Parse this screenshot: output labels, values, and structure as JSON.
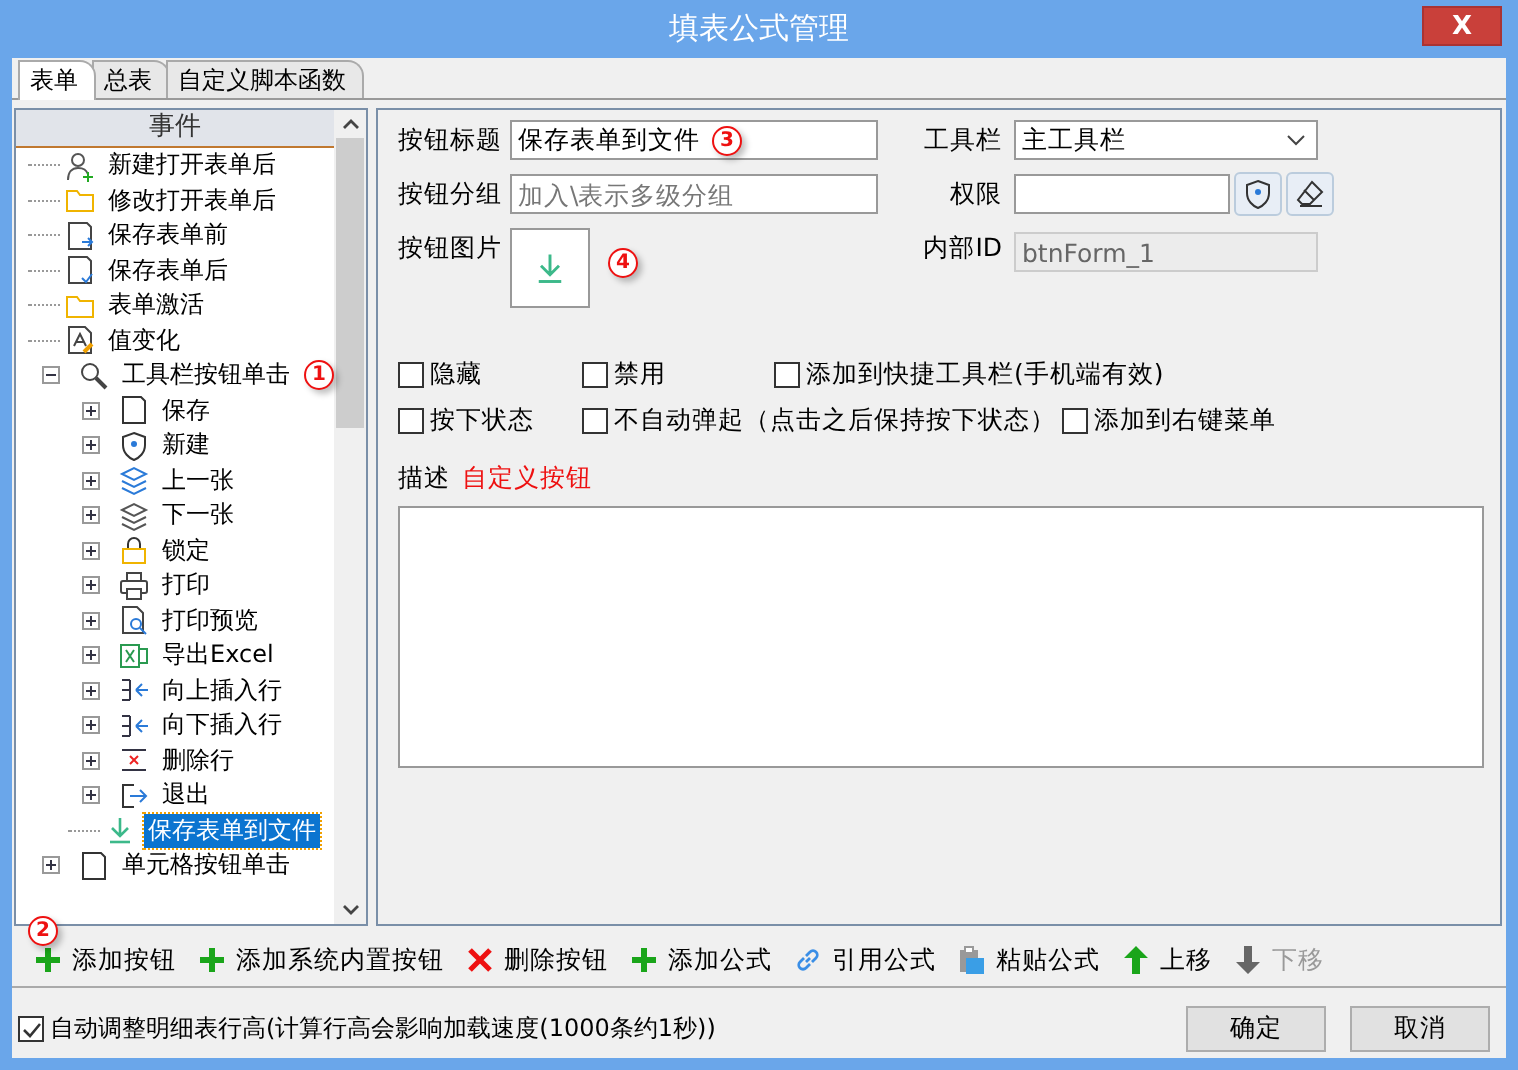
{
  "window": {
    "title": "填表公式管理",
    "close": "X"
  },
  "tabs": [
    {
      "label": "表单",
      "selected": true
    },
    {
      "label": "总表",
      "selected": false
    },
    {
      "label": "自定义脚本函数",
      "selected": false
    }
  ],
  "tree": {
    "header": "事件",
    "items": [
      {
        "label": "新建打开表单后",
        "selected": false
      },
      {
        "label": "修改打开表单后",
        "selected": false
      },
      {
        "label": "保存表单前",
        "selected": false
      },
      {
        "label": "保存表单后",
        "selected": false
      },
      {
        "label": "表单激活",
        "selected": false
      },
      {
        "label": "值变化",
        "selected": false
      },
      {
        "label": "工具栏按钮单击",
        "selected": false,
        "expanded": true,
        "badge": "1",
        "children": [
          {
            "label": "保存",
            "selected": false,
            "expanded": false
          },
          {
            "label": "新建",
            "selected": false,
            "expanded": false
          },
          {
            "label": "上一张",
            "selected": false,
            "expanded": false
          },
          {
            "label": "下一张",
            "selected": false,
            "expanded": false
          },
          {
            "label": "锁定",
            "selected": false,
            "expanded": false
          },
          {
            "label": "打印",
            "selected": false,
            "expanded": false
          },
          {
            "label": "打印预览",
            "selected": false,
            "expanded": false
          },
          {
            "label": "导出Excel",
            "selected": false,
            "expanded": false
          },
          {
            "label": "向上插入行",
            "selected": false,
            "expanded": false
          },
          {
            "label": "向下插入行",
            "selected": false,
            "expanded": false
          },
          {
            "label": "删除行",
            "selected": false,
            "expanded": false
          },
          {
            "label": "退出",
            "selected": false,
            "expanded": false
          },
          {
            "label": "保存表单到文件",
            "selected": true
          }
        ]
      },
      {
        "label": "单元格按钮单击",
        "selected": false,
        "expanded": false
      }
    ]
  },
  "form": {
    "title_label": "按钮标题",
    "title_value": "保存表单到文件",
    "title_badge": "3",
    "toolbar_label": "工具栏",
    "toolbar_value": "主工具栏",
    "group_label": "按钮分组",
    "group_placeholder": "加入\\表示多级分组",
    "permission_label": "权限",
    "image_label": "按钮图片",
    "image_badge": "4",
    "internal_id_label": "内部ID",
    "internal_id_value": "btnForm_1",
    "checkboxes": [
      {
        "label": "隐藏",
        "checked": false
      },
      {
        "label": "禁用",
        "checked": false
      },
      {
        "label": "添加到快捷工具栏(手机端有效)",
        "checked": false
      },
      {
        "label": "按下状态",
        "checked": false
      },
      {
        "label": "不自动弹起（点击之后保持按下状态）",
        "checked": false
      },
      {
        "label": "添加到右键菜单",
        "checked": false
      }
    ],
    "description_label": "描述",
    "description_value": "自定义按钮"
  },
  "toolbar": [
    {
      "label": "添加按钮",
      "kind": "add",
      "disabled": false,
      "badge": "2"
    },
    {
      "label": "添加系统内置按钮",
      "kind": "add",
      "disabled": false
    },
    {
      "label": "删除按钮",
      "kind": "delete",
      "disabled": false
    },
    {
      "label": "添加公式",
      "kind": "add",
      "disabled": false
    },
    {
      "label": "引用公式",
      "kind": "link",
      "disabled": false
    },
    {
      "label": "粘贴公式",
      "kind": "paste",
      "disabled": false
    },
    {
      "label": "上移",
      "kind": "up",
      "disabled": false
    },
    {
      "label": "下移",
      "kind": "down",
      "disabled": true
    }
  ],
  "footer": {
    "auto_adjust": {
      "label": "自动调整明细表行高(计算行高会影响加载速度(1000条约1秒))",
      "checked": true
    },
    "buttons": [
      "确定",
      "取消"
    ]
  }
}
